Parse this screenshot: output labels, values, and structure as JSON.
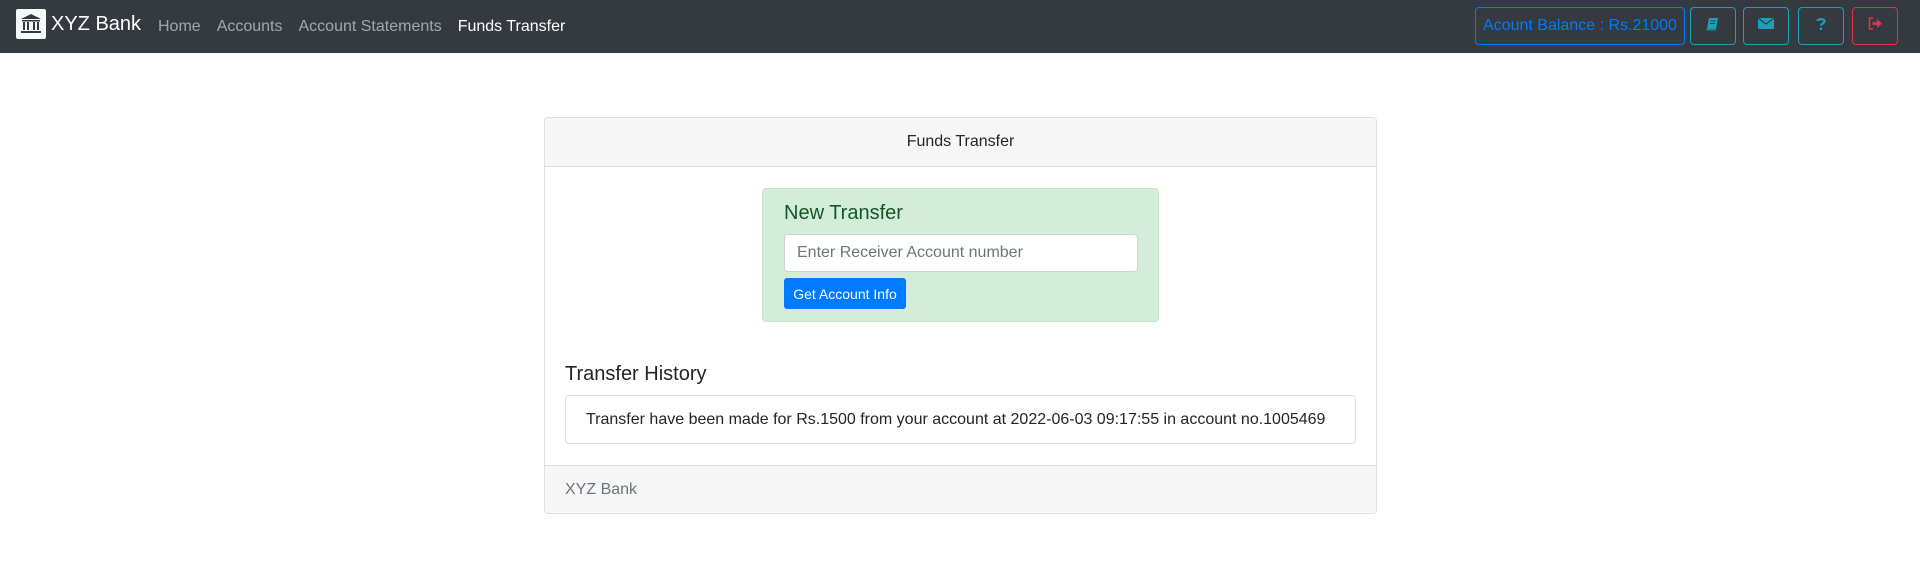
{
  "navbar": {
    "brand": "XYZ Bank",
    "brand_icon": "bank-icon",
    "links": [
      {
        "label": "Home",
        "active": false
      },
      {
        "label": "Accounts",
        "active": false
      },
      {
        "label": "Account Statements",
        "active": false
      },
      {
        "label": "Funds Transfer",
        "active": true
      }
    ],
    "balance_label": "Acount Balance : Rs.21000",
    "icon_buttons": [
      {
        "icon": "book-icon",
        "color": "#17a2b8"
      },
      {
        "icon": "envelope-icon",
        "color": "#17a2b8"
      },
      {
        "icon": "question-icon",
        "color": "#17a2b8"
      },
      {
        "icon": "sign-out-icon",
        "color": "#dc3545"
      }
    ]
  },
  "card": {
    "header": "Funds Transfer",
    "new_transfer": {
      "title": "New Transfer",
      "input_placeholder": "Enter Receiver Account number",
      "input_value": "",
      "button_label": "Get Account Info"
    },
    "history": {
      "title": "Transfer History",
      "items": [
        "Transfer have been made for Rs.1500 from your account at 2022-06-03 09:17:55 in account no.1005469"
      ]
    },
    "footer": "XYZ Bank"
  },
  "colors": {
    "navbar_bg": "#343a40",
    "primary": "#007bff",
    "info": "#17a2b8",
    "danger": "#dc3545",
    "success_bg": "#d4edda",
    "success_text": "#155724"
  }
}
